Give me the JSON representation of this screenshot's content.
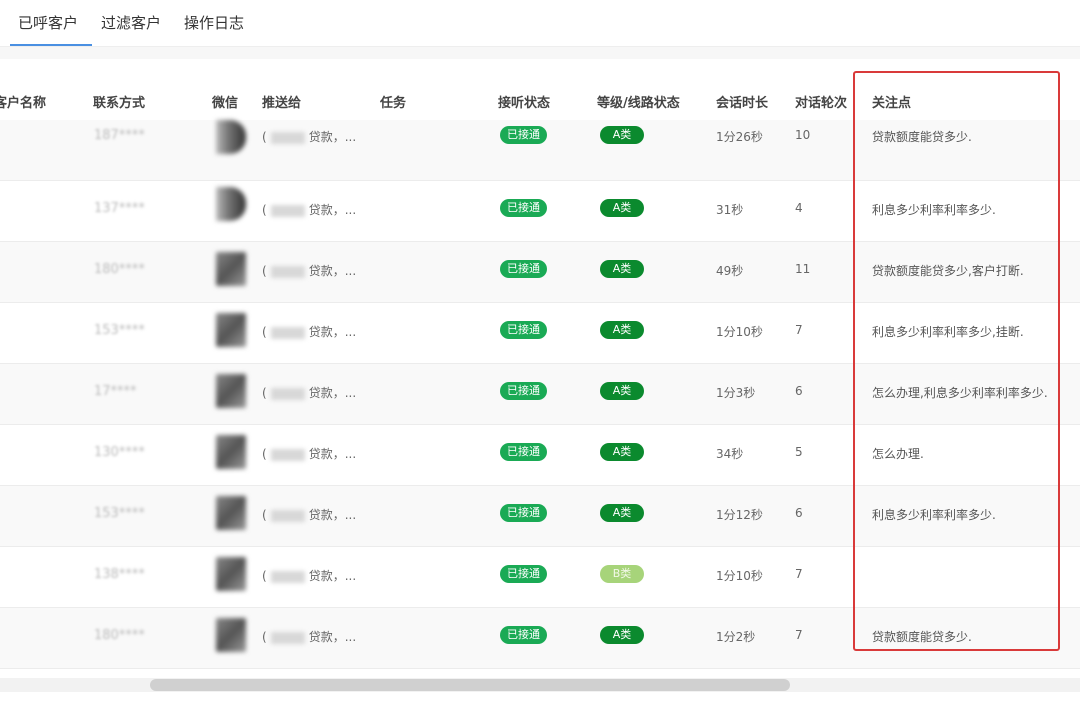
{
  "tabs": [
    {
      "label": "已呼客户",
      "active": true
    },
    {
      "label": "过滤客户",
      "active": false
    },
    {
      "label": "操作日志",
      "active": false
    }
  ],
  "columns": {
    "name": "客户名称",
    "contact": "联系方式",
    "wechat": "微信",
    "push_to": "推送给",
    "task": "任务",
    "answer_status": "接听状态",
    "grade": "等级/线路状态",
    "duration": "会话时长",
    "turns": "对话轮次",
    "focus": "关注点"
  },
  "rows": [
    {
      "phone": "187****",
      "push": "贷款，...",
      "status": "已接通",
      "grade": "A类",
      "duration": "1分26秒",
      "turns": "10",
      "focus": "贷款额度能贷多少."
    },
    {
      "phone": "137****",
      "push": "贷款，...",
      "status": "已接通",
      "grade": "A类",
      "duration": "31秒",
      "turns": "4",
      "focus": "利息多少利率利率多少."
    },
    {
      "phone": "180****",
      "push": "贷款，...",
      "status": "已接通",
      "grade": "A类",
      "duration": "49秒",
      "turns": "11",
      "focus": "贷款额度能贷多少,客户打断."
    },
    {
      "phone": "153****",
      "push": "贷款，...",
      "status": "已接通",
      "grade": "A类",
      "duration": "1分10秒",
      "turns": "7",
      "focus": "利息多少利率利率多少,挂断."
    },
    {
      "phone": "17****",
      "push": "贷款，...",
      "status": "已接通",
      "grade": "A类",
      "duration": "1分3秒",
      "turns": "6",
      "focus": "怎么办理,利息多少利率利率多少."
    },
    {
      "phone": "130****",
      "push": "贷款，...",
      "status": "已接通",
      "grade": "A类",
      "duration": "34秒",
      "turns": "5",
      "focus": "怎么办理."
    },
    {
      "phone": "153****",
      "push": "贷款，...",
      "status": "已接通",
      "grade": "A类",
      "duration": "1分12秒",
      "turns": "6",
      "focus": "利息多少利率利率多少."
    },
    {
      "phone": "138****",
      "push": "贷款，...",
      "status": "已接通",
      "grade": "B类",
      "duration": "1分10秒",
      "turns": "7",
      "focus": ""
    },
    {
      "phone": "180****",
      "push": "贷款，...",
      "status": "已接通",
      "grade": "A类",
      "duration": "1分2秒",
      "turns": "7",
      "focus": "贷款额度能贷多少."
    }
  ],
  "colors": {
    "highlight": "#d93a3a",
    "connected": "#1aaa55",
    "grade_a": "#0b8a2e",
    "grade_b": "#a7d47a"
  }
}
